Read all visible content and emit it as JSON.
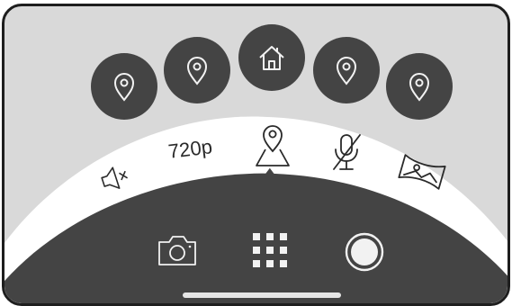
{
  "top_bar": {
    "pins": [
      {
        "icon": "location-pin-icon"
      },
      {
        "icon": "location-pin-icon"
      },
      {
        "icon": "home-icon"
      },
      {
        "icon": "location-pin-icon"
      },
      {
        "icon": "location-pin-icon"
      }
    ]
  },
  "arc_menu": {
    "items": [
      {
        "icon": "speaker-mute-icon"
      },
      {
        "label": "720p"
      },
      {
        "icon": "map-pin-icon",
        "selected": true
      },
      {
        "icon": "mic-off-icon"
      },
      {
        "icon": "panorama-icon"
      }
    ]
  },
  "bottom_bar": {
    "items": [
      {
        "icon": "camera-icon"
      },
      {
        "icon": "grid-icon"
      },
      {
        "icon": "record-icon"
      }
    ]
  },
  "colors": {
    "background": "#d9d9d9",
    "arc": "#ffffff",
    "dark": "#444444",
    "icon_stroke": "#2a2a2a",
    "icon_light": "#f2f2f2"
  }
}
